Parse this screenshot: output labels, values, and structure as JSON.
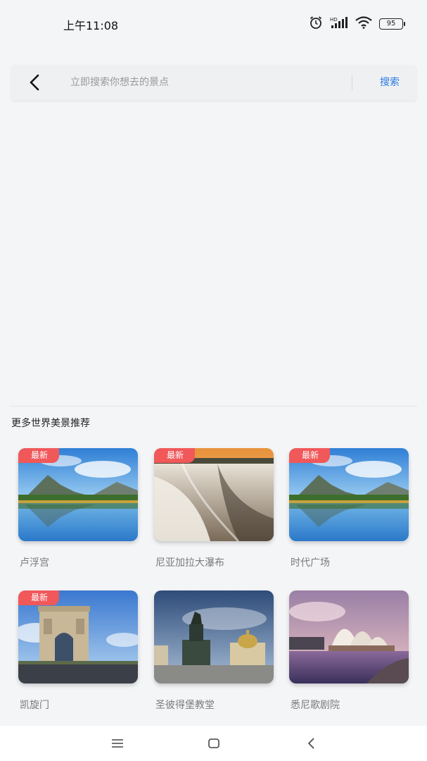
{
  "status_bar": {
    "time": "上午11:08",
    "battery": "95",
    "icons": [
      "alarm-icon",
      "hd-signal-icon",
      "wifi-icon",
      "battery-icon"
    ]
  },
  "search": {
    "placeholder": "立即搜索你想去的景点",
    "value": "",
    "button_label": "搜索",
    "back_icon": "chevron-left-icon"
  },
  "recommend": {
    "title": "更多世界美景推荐",
    "items": [
      {
        "label": "卢浮宫",
        "badge": "最新",
        "image": "mountain-lake"
      },
      {
        "label": "尼亚加拉大瀑布",
        "badge": "最新",
        "image": "waterfall"
      },
      {
        "label": "时代广场",
        "badge": "最新",
        "image": "mountain-lake"
      },
      {
        "label": "凯旋门",
        "badge": "最新",
        "image": "arc-de-triomphe"
      },
      {
        "label": "圣彼得堡教堂",
        "badge": "",
        "image": "cathedral-statue"
      },
      {
        "label": "悉尼歌剧院",
        "badge": "",
        "image": "opera-house"
      }
    ]
  },
  "nav_bar": {
    "icons": [
      "menu-icon",
      "home-square-icon",
      "back-chevron-icon"
    ]
  },
  "colors": {
    "accent": "#2a7be0",
    "badge": "#f0585a",
    "background": "#f4f5f7"
  }
}
